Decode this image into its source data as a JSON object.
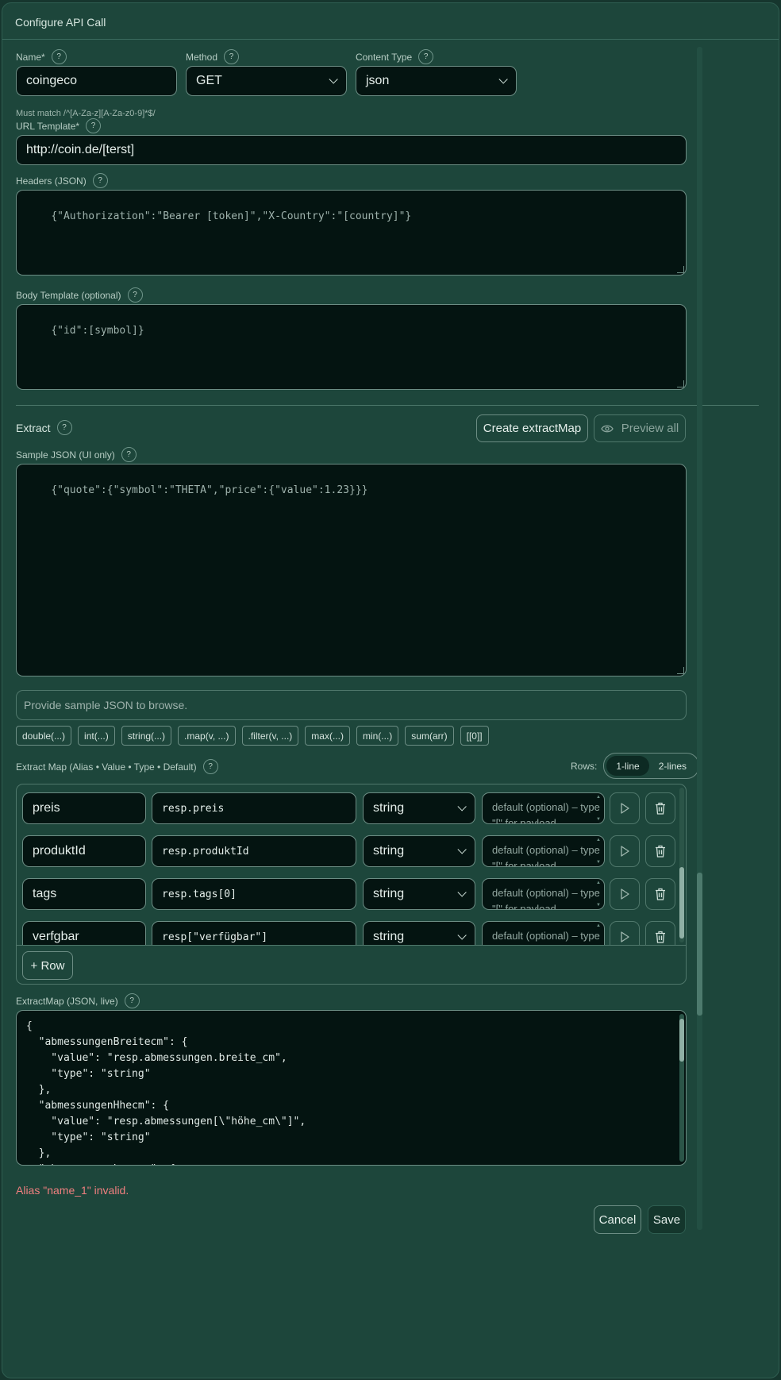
{
  "modal": {
    "title": "Configure API Call"
  },
  "name": {
    "label": "Name*",
    "value": "coingeco",
    "hint": "Must match /^[A-Za-z][A-Za-z0-9]*$/"
  },
  "method": {
    "label": "Method",
    "value": "GET"
  },
  "content_type": {
    "label": "Content Type",
    "value": "json"
  },
  "url": {
    "label": "URL Template*",
    "value": "http://coin.de/[terst]"
  },
  "headers": {
    "label": "Headers (JSON)",
    "value": "{\"Authorization\":\"Bearer [token]\",\"X-Country\":\"[country]\"}"
  },
  "body": {
    "label": "Body Template (optional)",
    "value": "{\"id\":[symbol]}"
  },
  "extract": {
    "label": "Extract",
    "create_button": "Create extractMap",
    "preview_button": "Preview all",
    "sample_label": "Sample JSON (UI only)",
    "sample_value": "{\"quote\":{\"symbol\":\"THETA\",\"price\":{\"value\":1.23}}}",
    "browse_placeholder": "Provide sample JSON to browse.",
    "chips": [
      "double(...)",
      "int(...)",
      "string(...)",
      ".map(v, ...)",
      ".filter(v, ...)",
      "max(...)",
      "min(...)",
      "sum(arr)",
      "[[0]]"
    ]
  },
  "extract_map": {
    "label": "Extract Map (Alias • Value • Type • Default)",
    "rows_label": "Rows:",
    "rows_options": [
      "1-line",
      "2-lines"
    ],
    "rows_selected": "1-line",
    "default_placeholder": "default (optional) – type \"[\" for payload",
    "rows": [
      {
        "alias": "preis",
        "value": "resp.preis",
        "type": "string"
      },
      {
        "alias": "produktId",
        "value": "resp.produktId",
        "type": "string"
      },
      {
        "alias": "tags",
        "value": "resp.tags[0]",
        "type": "string"
      },
      {
        "alias": "verfgbar",
        "value": "resp[\"verfügbar\"]",
        "type": "string"
      }
    ],
    "add_row_button": "+ Row"
  },
  "extract_map_json": {
    "label": "ExtractMap (JSON, live)",
    "value": "{\n  \"abmessungenBreitecm\": {\n    \"value\": \"resp.abmessungen.breite_cm\",\n    \"type\": \"string\"\n  },\n  \"abmessungenHhecm\": {\n    \"value\": \"resp.abmessungen[\\\"höhe_cm\\\"]\",\n    \"type\": \"string\"\n  },\n  \"abmessungenLngecm\": {\n    \"value\": \"resp.abmessungen[\\\"länge_cm\\\"]\","
  },
  "error": "Alias \"name_1\" invalid.",
  "footer": {
    "cancel": "Cancel",
    "save": "Save"
  },
  "colors": {
    "background": "#1d463b",
    "input_bg": "#041411",
    "error": "#f07f7f"
  }
}
